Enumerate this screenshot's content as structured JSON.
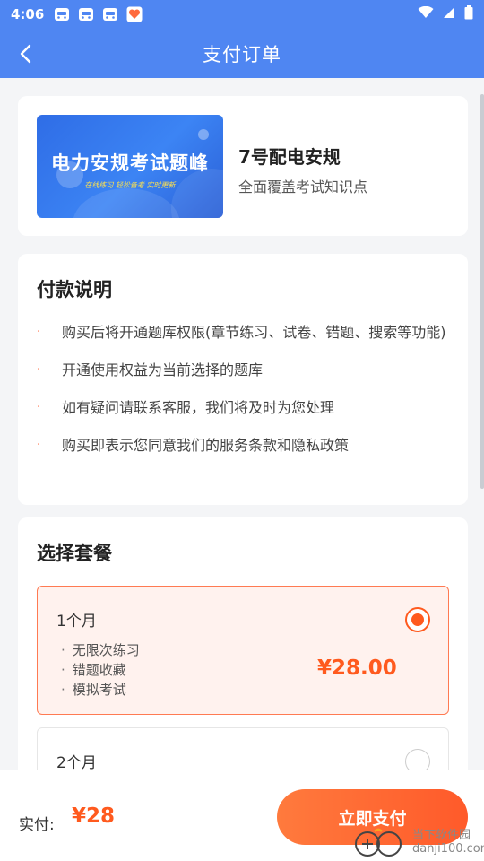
{
  "status_bar": {
    "time": "4:06"
  },
  "header": {
    "title": "支付订单"
  },
  "product": {
    "banner_title": "电力安规考试题峰",
    "banner_subtitle": "在线练习  轻松备考  实时更新",
    "name": "7号配电安规",
    "desc": "全面覆盖考试知识点"
  },
  "payment_info": {
    "title": "付款说明",
    "items": [
      "购买后将开通题库权限(章节练习、试卷、错题、搜索等功能)",
      "开通使用权益为当前选择的题库",
      "如有疑问请联系客服，我们将及时为您处理",
      "购买即表示您同意我们的服务条款和隐私政策"
    ]
  },
  "plans": {
    "title": "选择套餐",
    "options": [
      {
        "name": "1个月",
        "features": [
          "无限次练习",
          "错题收藏",
          "模拟考试"
        ],
        "price": "¥28.00",
        "selected": true
      },
      {
        "name": "2个月",
        "selected": false
      }
    ]
  },
  "footer": {
    "paid_label": "实付:",
    "amount": "¥28",
    "pay_button": "立即支付"
  },
  "watermark": {
    "site_cn": "当下软件园",
    "site_url": "danji100.com"
  },
  "colors": {
    "primary_blue": "#4f86f2",
    "accent_orange": "#ff5a1e",
    "page_bg": "#f4f5f7"
  }
}
